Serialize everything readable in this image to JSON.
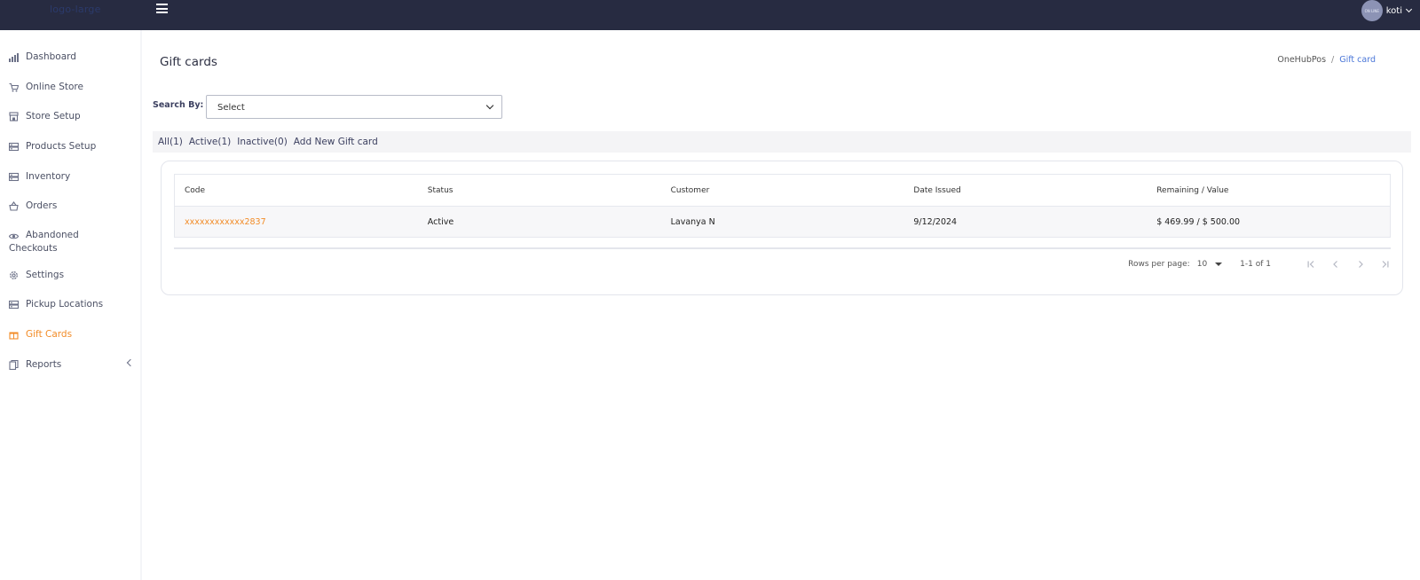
{
  "header": {
    "logo_text": "logo-large",
    "user_name": "koti",
    "avatar_text": "ON LINE"
  },
  "sidebar": {
    "items": [
      {
        "label": "Dashboard",
        "icon": "bar-chart-icon"
      },
      {
        "label": "Online Store",
        "icon": "cart-icon"
      },
      {
        "label": "Store Setup",
        "icon": "storefront-icon"
      },
      {
        "label": "Products Setup",
        "icon": "box-icon"
      },
      {
        "label": "Inventory",
        "icon": "inventory-icon"
      },
      {
        "label": "Orders",
        "icon": "basket-icon"
      },
      {
        "label": "Abandoned Checkouts",
        "icon": "eye-icon"
      },
      {
        "label": "Settings",
        "icon": "gear-icon"
      },
      {
        "label": "Pickup Locations",
        "icon": "location-icon"
      },
      {
        "label": "Gift Cards",
        "icon": "gift-icon"
      },
      {
        "label": "Reports",
        "icon": "report-icon"
      }
    ],
    "active_color": "#f28c28"
  },
  "page": {
    "title": "Gift cards",
    "breadcrumb": [
      "OneHubPos",
      "Gift card"
    ]
  },
  "search": {
    "label": "Search By:",
    "value": "Select"
  },
  "filters": [
    "All(1)",
    "Active(1)",
    "Inactive(0)",
    "Add New Gift card"
  ],
  "table": {
    "columns": [
      "Code",
      "Status",
      "Customer",
      "Date Issued",
      "Remaining / Value"
    ],
    "rows": [
      [
        "xxxxxxxxxxxx2837",
        "Active",
        "Lavanya N",
        "9/12/2024",
        "$ 469.99 / $ 500.00"
      ]
    ]
  },
  "pagination": {
    "rows_per_page_label": "Rows per page:",
    "rows_per_page": "10",
    "range": "1-1 of 1"
  },
  "colors": {
    "topbar": "#272b41",
    "accent": "#f28c28",
    "link": "#4a76d8"
  }
}
